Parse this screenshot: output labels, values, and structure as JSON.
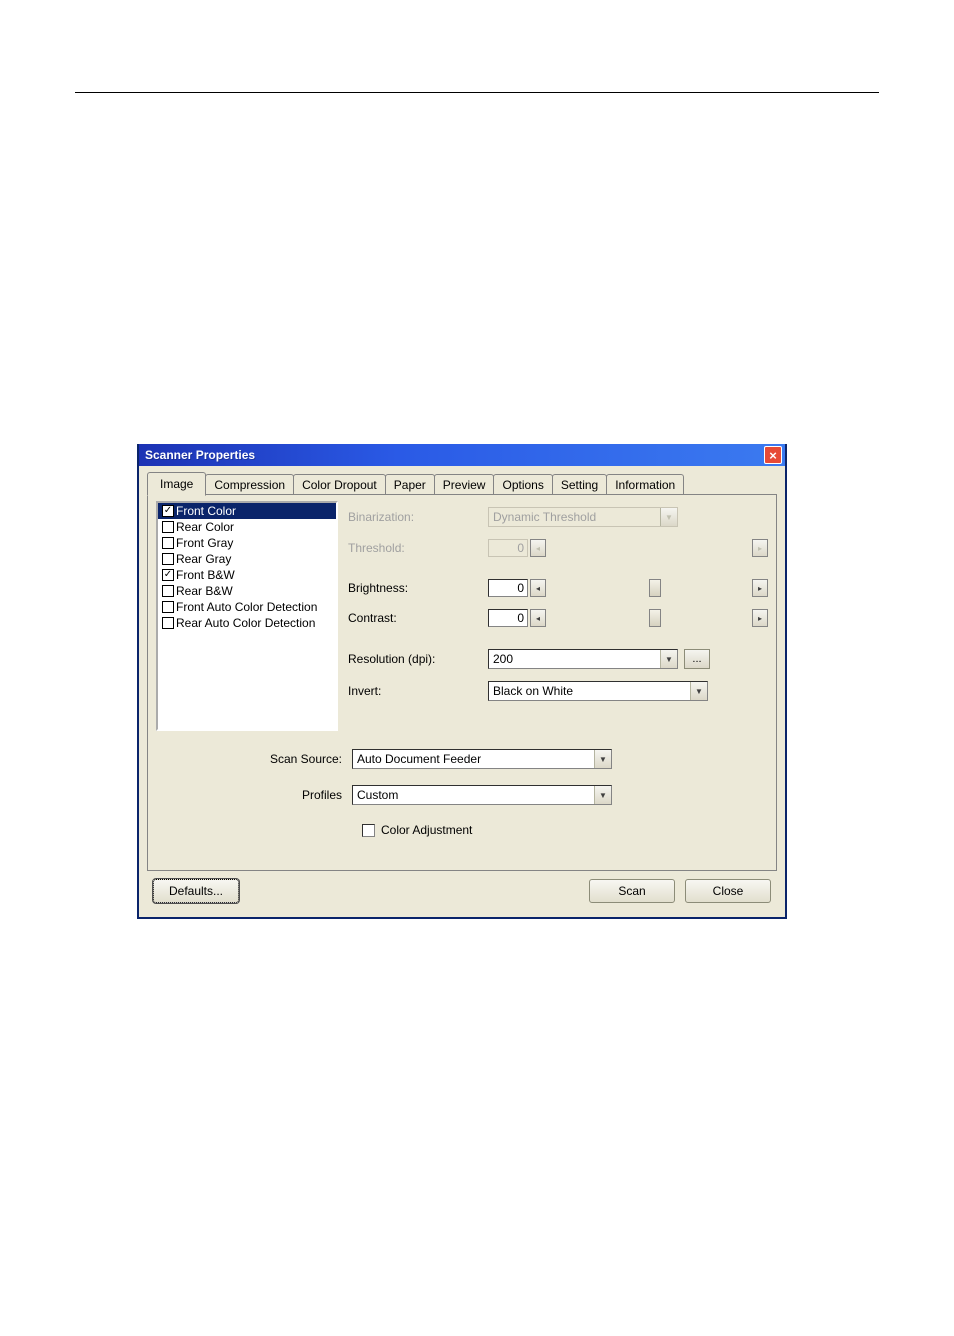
{
  "dialog": {
    "title": "Scanner Properties",
    "close_label": "×"
  },
  "tabs": [
    {
      "label": "Image"
    },
    {
      "label": "Compression"
    },
    {
      "label": "Color Dropout"
    },
    {
      "label": "Paper"
    },
    {
      "label": "Preview"
    },
    {
      "label": "Options"
    },
    {
      "label": "Setting"
    },
    {
      "label": "Information"
    }
  ],
  "image_list": [
    {
      "label": "Front Color",
      "checked": true,
      "selected": true
    },
    {
      "label": "Rear Color",
      "checked": false
    },
    {
      "label": "Front Gray",
      "checked": false
    },
    {
      "label": "Rear Gray",
      "checked": false
    },
    {
      "label": "Front B&W",
      "checked": true
    },
    {
      "label": "Rear B&W",
      "checked": false
    },
    {
      "label": "Front Auto Color Detection",
      "checked": false
    },
    {
      "label": "Rear Auto Color Detection",
      "checked": false
    }
  ],
  "settings": {
    "binarization": {
      "label": "Binarization:",
      "value": "Dynamic Threshold"
    },
    "threshold": {
      "label": "Threshold:",
      "value": "0"
    },
    "brightness": {
      "label": "Brightness:",
      "value": "0"
    },
    "contrast": {
      "label": "Contrast:",
      "value": "0"
    },
    "resolution": {
      "label": "Resolution (dpi):",
      "value": "200",
      "more": "..."
    },
    "invert": {
      "label": "Invert:",
      "value": "Black on White"
    }
  },
  "lower": {
    "scan_source": {
      "label": "Scan Source:",
      "value": "Auto Document Feeder"
    },
    "profiles": {
      "label": "Profiles",
      "value": "Custom"
    },
    "color_adj": {
      "label": "Color Adjustment"
    }
  },
  "buttons": {
    "defaults": "Defaults...",
    "scan": "Scan",
    "close": "Close"
  }
}
